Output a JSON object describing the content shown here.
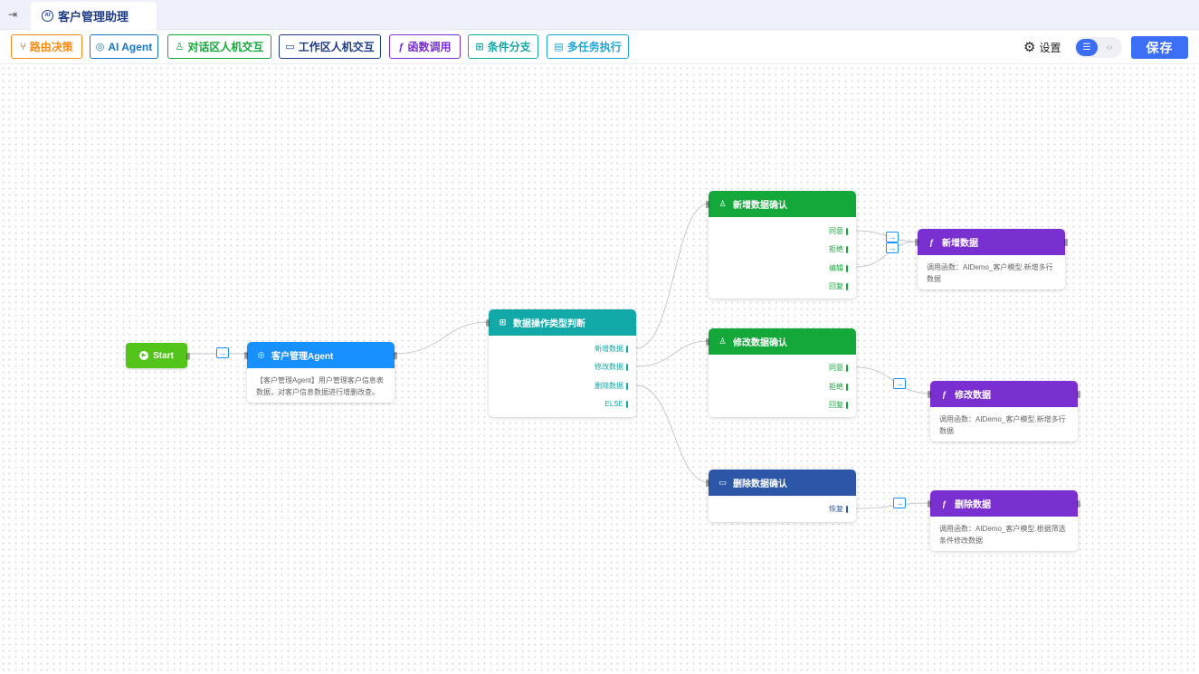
{
  "tab": {
    "title": "客户管理助理",
    "icon": "AI"
  },
  "toolbar": {
    "buttons": [
      {
        "label": "路由决策",
        "icon": "branch-icon",
        "glyph": "⑂",
        "color": "#fa8c16"
      },
      {
        "label": "AI Agent",
        "icon": "ai-brain-icon",
        "glyph": "◎",
        "color": "#1677c8"
      },
      {
        "label": "对话区人机交互",
        "icon": "user-icon",
        "glyph": "♙",
        "color": "#14a83b"
      },
      {
        "label": "工作区人机交互",
        "icon": "monitor-icon",
        "glyph": "▭",
        "color": "#1f3c88"
      },
      {
        "label": "函数调用",
        "icon": "function-icon",
        "glyph": "ƒ",
        "color": "#7a2fd1"
      },
      {
        "label": "条件分支",
        "icon": "condition-icon",
        "glyph": "⊞",
        "color": "#13a8a8"
      },
      {
        "label": "多任务执行",
        "icon": "tasks-icon",
        "glyph": "▤",
        "color": "#1aa6d8"
      }
    ],
    "settings_label": "设置",
    "save_label": "保存"
  },
  "flow": {
    "start": {
      "label": "Start"
    },
    "agent": {
      "title": "客户管理Agent",
      "desc": "【客户管理Agent】用户管理客户信息表数据，对客户信息数据进行增删改查。"
    },
    "condition": {
      "title": "数据操作类型判断",
      "outputs": [
        "新增数据",
        "修改数据",
        "删除数据",
        "ELSE"
      ]
    },
    "confirm_add": {
      "title": "新增数据确认",
      "outputs": [
        "同意",
        "拒绝",
        "编辑",
        "回复"
      ]
    },
    "confirm_edit": {
      "title": "修改数据确认",
      "outputs": [
        "同意",
        "拒绝",
        "回复"
      ]
    },
    "confirm_delete": {
      "title": "删除数据确认",
      "outputs": [
        "恢复"
      ]
    },
    "func_add": {
      "title": "新增数据",
      "desc": "调用函数：AIDemo_客户模型.新增多行数据"
    },
    "func_edit": {
      "title": "修改数据",
      "desc": "调用函数：AIDemo_客户模型.新增多行数据"
    },
    "func_delete": {
      "title": "删除数据",
      "desc": "调用函数：AIDemo_客户模型.根据筛选条件修改数据"
    }
  },
  "colors": {
    "start": "#52c41a",
    "agent": "#1890ff",
    "condition": "#13a8a8",
    "confirm_green": "#14a83b",
    "confirm_blue": "#2b57a6",
    "function": "#7a2fd1"
  }
}
